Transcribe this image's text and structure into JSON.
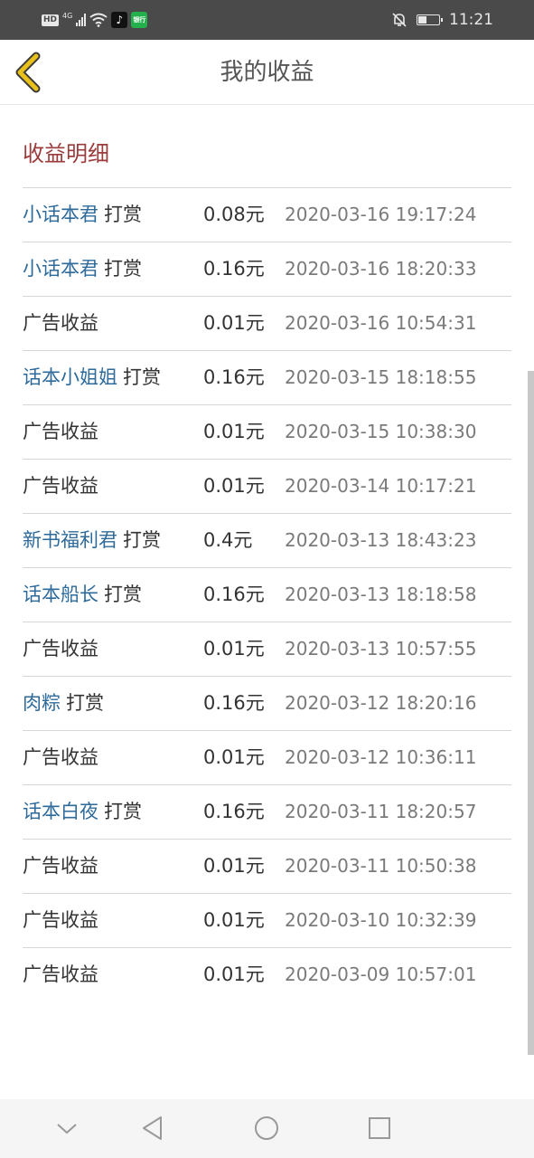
{
  "status_bar": {
    "left_text": "HD",
    "network": "4G",
    "app2_label": "银行",
    "time": "11:21",
    "battery_level_pct": 40
  },
  "header": {
    "title": "我的收益",
    "back_icon": "chevron-left-icon",
    "back_color": "#e8c21a"
  },
  "section": {
    "title": "收益明细"
  },
  "records": [
    {
      "user": "小话本君",
      "action": "打赏",
      "label": "",
      "amount": "0.08元",
      "time": "2020-03-16 19:17:24"
    },
    {
      "user": "小话本君",
      "action": "打赏",
      "label": "",
      "amount": "0.16元",
      "time": "2020-03-16 18:20:33"
    },
    {
      "user": "",
      "action": "",
      "label": "广告收益",
      "amount": "0.01元",
      "time": "2020-03-16 10:54:31"
    },
    {
      "user": "话本小姐姐",
      "action": "打赏",
      "label": "",
      "amount": "0.16元",
      "time": "2020-03-15 18:18:55"
    },
    {
      "user": "",
      "action": "",
      "label": "广告收益",
      "amount": "0.01元",
      "time": "2020-03-15 10:38:30"
    },
    {
      "user": "",
      "action": "",
      "label": "广告收益",
      "amount": "0.01元",
      "time": "2020-03-14 10:17:21"
    },
    {
      "user": "新书福利君",
      "action": "打赏",
      "label": "",
      "amount": "0.4元",
      "time": "2020-03-13 18:43:23"
    },
    {
      "user": "话本船长",
      "action": "打赏",
      "label": "",
      "amount": "0.16元",
      "time": "2020-03-13 18:18:58"
    },
    {
      "user": "",
      "action": "",
      "label": "广告收益",
      "amount": "0.01元",
      "time": "2020-03-13 10:57:55"
    },
    {
      "user": "肉粽",
      "action": "打赏",
      "label": "",
      "amount": "0.16元",
      "time": "2020-03-12 18:20:16"
    },
    {
      "user": "",
      "action": "",
      "label": "广告收益",
      "amount": "0.01元",
      "time": "2020-03-12 10:36:11"
    },
    {
      "user": "话本白夜",
      "action": "打赏",
      "label": "",
      "amount": "0.16元",
      "time": "2020-03-11 18:20:57"
    },
    {
      "user": "",
      "action": "",
      "label": "广告收益",
      "amount": "0.01元",
      "time": "2020-03-11 10:50:38"
    },
    {
      "user": "",
      "action": "",
      "label": "广告收益",
      "amount": "0.01元",
      "time": "2020-03-10 10:32:39"
    },
    {
      "user": "",
      "action": "",
      "label": "广告收益",
      "amount": "0.01元",
      "time": "2020-03-09 10:57:01"
    }
  ],
  "colors": {
    "user_link": "#2e6b9b",
    "section_title": "#9b3b3b",
    "status_bar_bg": "#4a4a4a"
  },
  "bottom_nav": {
    "icons": [
      "chevron-down-icon",
      "back-triangle-icon",
      "home-circle-icon",
      "recents-square-icon"
    ]
  }
}
